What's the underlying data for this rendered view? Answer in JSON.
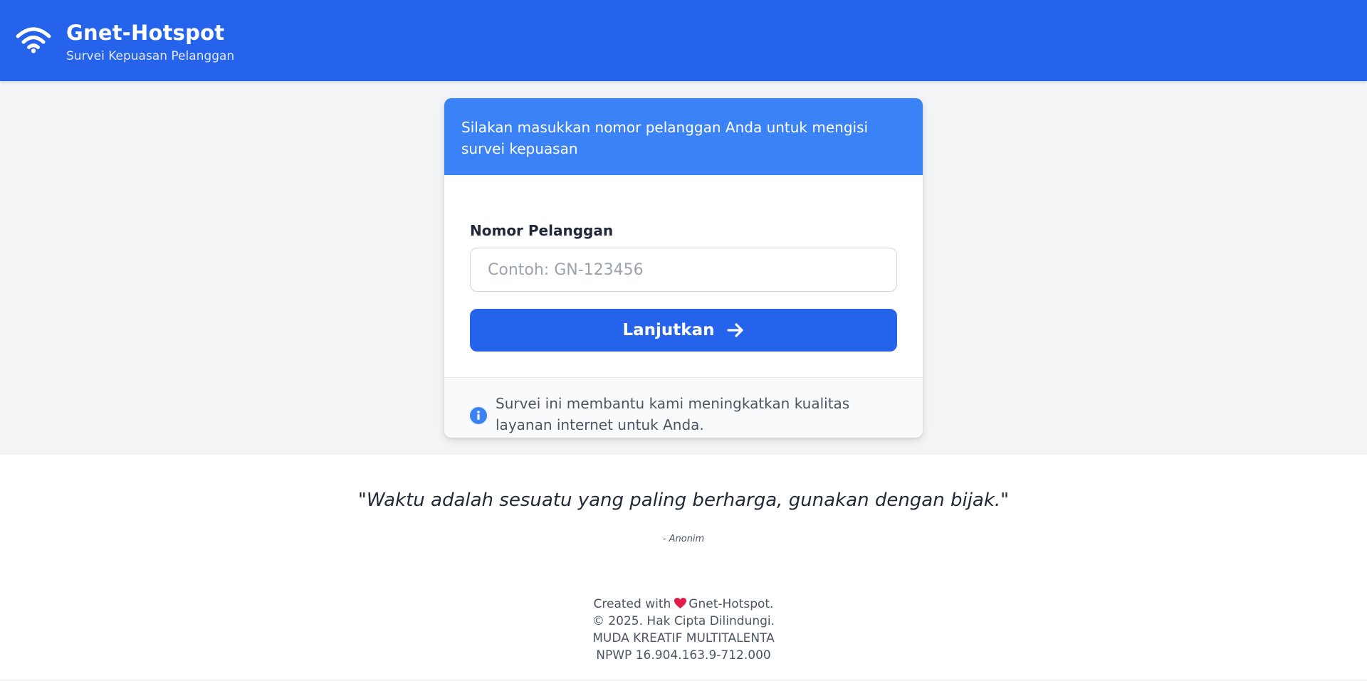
{
  "header": {
    "title": "Gnet-Hotspot",
    "subtitle": "Survei Kepuasan Pelanggan",
    "icon": "wifi-icon"
  },
  "card": {
    "intro": "Silakan masukkan nomor pelanggan Anda untuk mengisi survei kepuasan",
    "field_label": "Nomor Pelanggan",
    "input_value": "",
    "input_placeholder": "Contoh: GN-123456",
    "submit_label": "Lanjutkan",
    "info_text": "Survei ini membantu kami meningkatkan kualitas layanan internet untuk Anda."
  },
  "quote": {
    "text": "\"Waktu adalah sesuatu yang paling berharga, gunakan dengan bijak.\"",
    "author": "- Anonim"
  },
  "footer": {
    "created_prefix": "Created with",
    "created_suffix": "Gnet-Hotspot.",
    "copyright": "© 2025. Hak Cipta Dilindungi.",
    "company": "MUDA KREATIF MULTITALENTA",
    "npwp": "NPWP 16.904.163.9-712.000"
  },
  "colors": {
    "primary": "#2563eb",
    "card_header": "#3b82f6",
    "background": "#f3f4f6",
    "heart": "#e11d48"
  }
}
